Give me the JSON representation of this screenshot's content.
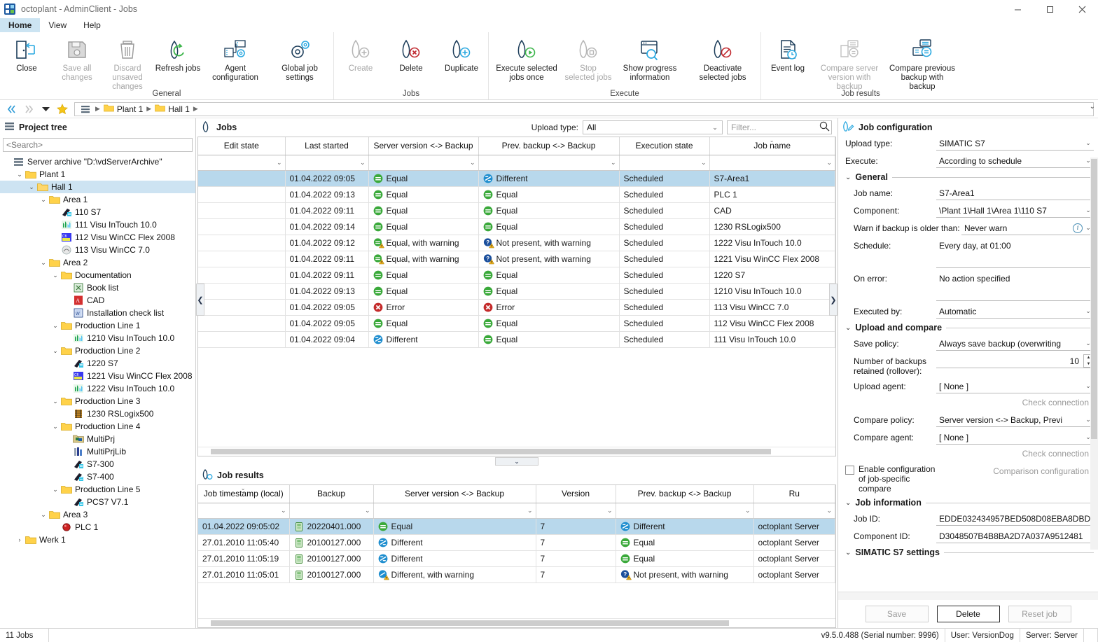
{
  "window": {
    "title": "octoplant - AdminClient - Jobs",
    "app_icon": "octoplant-logo-icon",
    "minimize": "minimize-icon",
    "maximize": "maximize-icon",
    "close": "close-icon"
  },
  "menubar": {
    "items": [
      "Home",
      "View",
      "Help"
    ],
    "active": "Home"
  },
  "ribbon": {
    "groups": [
      {
        "label": "General",
        "buttons": [
          {
            "label": "Close",
            "icon": "door-exit-icon",
            "disabled": false
          },
          {
            "label": "Save all changes",
            "icon": "floppy-save-icon",
            "disabled": true
          },
          {
            "label": "Discard unsaved changes",
            "icon": "trash-bin-icon",
            "disabled": true
          },
          {
            "label": "Refresh jobs",
            "icon": "refresh-arrows-icon",
            "disabled": false
          },
          {
            "label": "Agent configuration",
            "icon": "server-gear-icon",
            "disabled": false
          },
          {
            "label": "Global job settings",
            "icon": "gears-icon",
            "disabled": false
          }
        ]
      },
      {
        "label": "Jobs",
        "buttons": [
          {
            "label": "Create",
            "icon": "job-plus-icon",
            "disabled": true
          },
          {
            "label": "Delete",
            "icon": "job-delete-icon",
            "disabled": false
          },
          {
            "label": "Duplicate",
            "icon": "job-duplicate-icon",
            "disabled": false
          }
        ]
      },
      {
        "label": "Execute",
        "buttons": [
          {
            "label": "Execute selected jobs once",
            "icon": "job-play-icon",
            "disabled": false
          },
          {
            "label": "Stop selected jobs",
            "icon": "job-stop-icon",
            "disabled": true
          },
          {
            "label": "Show progress information",
            "icon": "window-search-icon",
            "disabled": false
          },
          {
            "label": "Deactivate selected jobs",
            "icon": "job-deactivate-icon",
            "disabled": false
          }
        ]
      },
      {
        "label": "Job results",
        "buttons": [
          {
            "label": "Event log",
            "icon": "document-clock-icon",
            "disabled": false
          },
          {
            "label": "Compare server version with backup",
            "icon": "compare-server-backup-icon",
            "disabled": true
          },
          {
            "label": "Compare previous backup with backup",
            "icon": "compare-backup-backup-icon",
            "disabled": false
          }
        ]
      }
    ]
  },
  "breadcrumb": {
    "back": "back-icon",
    "forward": "forward-icon",
    "history": "history-dropdown-icon",
    "favorite": "favorite-star-icon",
    "root": "project-tree-icon",
    "items": [
      "Plant 1",
      "Hall 1"
    ],
    "collapse": "ribbon-collapse-icon"
  },
  "tree_pane": {
    "icon": "project-tree-icon",
    "title": "Project tree",
    "search_placeholder": "<Search>",
    "search_value": "",
    "nodes": [
      {
        "label": "Server archive \"D:\\vdServerArchive\"",
        "depth": 0,
        "twist": "",
        "icon": "archive-icon",
        "selected": false
      },
      {
        "label": "Plant 1",
        "depth": 1,
        "twist": "v",
        "icon": "folder-icon",
        "selected": false
      },
      {
        "label": "Hall 1",
        "depth": 2,
        "twist": "v",
        "icon": "folder-open-icon",
        "selected": true
      },
      {
        "label": "Area 1",
        "depth": 3,
        "twist": "v",
        "icon": "folder-icon",
        "selected": false
      },
      {
        "label": "110 S7",
        "depth": 4,
        "twist": "",
        "icon": "plc-s7-icon",
        "selected": false
      },
      {
        "label": "111 Visu InTouch 10.0",
        "depth": 4,
        "twist": "",
        "icon": "hmi-intouch-icon",
        "selected": false
      },
      {
        "label": "112 Visu WinCC Flex 2008",
        "depth": 4,
        "twist": "",
        "icon": "hmi-winccflex-icon",
        "selected": false
      },
      {
        "label": "113 Visu WinCC 7.0",
        "depth": 4,
        "twist": "",
        "icon": "hmi-wincc-icon",
        "selected": false
      },
      {
        "label": "Area 2",
        "depth": 3,
        "twist": "v",
        "icon": "folder-icon",
        "selected": false
      },
      {
        "label": "Documentation",
        "depth": 4,
        "twist": "v",
        "icon": "folder-icon",
        "selected": false
      },
      {
        "label": "Book list",
        "depth": 5,
        "twist": "",
        "icon": "excel-file-icon",
        "selected": false
      },
      {
        "label": "CAD",
        "depth": 5,
        "twist": "",
        "icon": "pdf-file-icon",
        "selected": false
      },
      {
        "label": "Installation check list",
        "depth": 5,
        "twist": "",
        "icon": "word-file-icon",
        "selected": false
      },
      {
        "label": "Production Line 1",
        "depth": 4,
        "twist": "v",
        "icon": "folder-icon",
        "selected": false
      },
      {
        "label": "1210 Visu InTouch 10.0",
        "depth": 5,
        "twist": "",
        "icon": "hmi-intouch-icon",
        "selected": false
      },
      {
        "label": "Production Line 2",
        "depth": 4,
        "twist": "v",
        "icon": "folder-icon",
        "selected": false
      },
      {
        "label": "1220 S7",
        "depth": 5,
        "twist": "",
        "icon": "plc-s7-icon",
        "selected": false
      },
      {
        "label": "1221 Visu WinCC Flex 2008",
        "depth": 5,
        "twist": "",
        "icon": "hmi-winccflex-icon",
        "selected": false
      },
      {
        "label": "1222 Visu InTouch 10.0",
        "depth": 5,
        "twist": "",
        "icon": "hmi-intouch-icon",
        "selected": false
      },
      {
        "label": "Production Line 3",
        "depth": 4,
        "twist": "v",
        "icon": "folder-icon",
        "selected": false
      },
      {
        "label": "1230 RSLogix500",
        "depth": 5,
        "twist": "",
        "icon": "plc-rslogix-icon",
        "selected": false
      },
      {
        "label": "Production Line 4",
        "depth": 4,
        "twist": "v",
        "icon": "folder-icon",
        "selected": false
      },
      {
        "label": "MultiPrj",
        "depth": 5,
        "twist": "",
        "icon": "multiprj-icon",
        "selected": false
      },
      {
        "label": "MultiPrjLib",
        "depth": 5,
        "twist": "",
        "icon": "multiprjlib-icon",
        "selected": false
      },
      {
        "label": "S7-300",
        "depth": 5,
        "twist": "",
        "icon": "plc-s7-icon",
        "selected": false
      },
      {
        "label": "S7-400",
        "depth": 5,
        "twist": "",
        "icon": "plc-s7-icon",
        "selected": false
      },
      {
        "label": "Production Line 5",
        "depth": 4,
        "twist": "v",
        "icon": "folder-icon",
        "selected": false
      },
      {
        "label": "PCS7 V7.1",
        "depth": 5,
        "twist": "",
        "icon": "plc-s7-icon",
        "selected": false
      },
      {
        "label": "Area 3",
        "depth": 3,
        "twist": "v",
        "icon": "folder-icon",
        "selected": false
      },
      {
        "label": "PLC 1",
        "depth": 4,
        "twist": "",
        "icon": "plc-red-icon",
        "selected": false
      },
      {
        "label": "Werk 1",
        "depth": 1,
        "twist": ">",
        "icon": "folder-icon",
        "selected": false
      }
    ]
  },
  "jobs_panel": {
    "icon": "jobs-icon",
    "title": "Jobs",
    "upload_type_label": "Upload type:",
    "upload_type_value": "All",
    "filter_placeholder": "Filter...",
    "filter_value": "",
    "search_icon": "search-icon",
    "columns": [
      "Edit state",
      "Last started",
      "Server version <-> Backup",
      "Prev. backup <-> Backup",
      "Execution state",
      "Job name"
    ],
    "sorted_column": "Job name",
    "rows": [
      {
        "edit_state": "",
        "last_started": "01.04.2022 09:05",
        "server_vs_backup": "Equal",
        "server_vs_backup_icon": "equal-green-icon",
        "prev_vs_backup": "Different",
        "prev_vs_backup_icon": "different-blue-icon",
        "execution_state": "Scheduled",
        "job_name": "S7-Area1",
        "selected": true
      },
      {
        "edit_state": "",
        "last_started": "01.04.2022 09:13",
        "server_vs_backup": "Equal",
        "server_vs_backup_icon": "equal-green-icon",
        "prev_vs_backup": "Equal",
        "prev_vs_backup_icon": "equal-green-icon",
        "execution_state": "Scheduled",
        "job_name": "PLC 1",
        "selected": false
      },
      {
        "edit_state": "",
        "last_started": "01.04.2022 09:11",
        "server_vs_backup": "Equal",
        "server_vs_backup_icon": "equal-green-icon",
        "prev_vs_backup": "Equal",
        "prev_vs_backup_icon": "equal-green-icon",
        "execution_state": "Scheduled",
        "job_name": "CAD",
        "selected": false
      },
      {
        "edit_state": "",
        "last_started": "01.04.2022 09:14",
        "server_vs_backup": "Equal",
        "server_vs_backup_icon": "equal-green-icon",
        "prev_vs_backup": "Equal",
        "prev_vs_backup_icon": "equal-green-icon",
        "execution_state": "Scheduled",
        "job_name": "1230 RSLogix500",
        "selected": false
      },
      {
        "edit_state": "",
        "last_started": "01.04.2022 09:12",
        "server_vs_backup": "Equal, with warning",
        "server_vs_backup_icon": "equal-warning-icon",
        "prev_vs_backup": "Not present, with warning",
        "prev_vs_backup_icon": "notpresent-warning-icon",
        "execution_state": "Scheduled",
        "job_name": "1222 Visu InTouch 10.0",
        "selected": false
      },
      {
        "edit_state": "",
        "last_started": "01.04.2022 09:11",
        "server_vs_backup": "Equal, with warning",
        "server_vs_backup_icon": "equal-warning-icon",
        "prev_vs_backup": "Not present, with warning",
        "prev_vs_backup_icon": "notpresent-warning-icon",
        "execution_state": "Scheduled",
        "job_name": "1221 Visu WinCC Flex 2008",
        "selected": false
      },
      {
        "edit_state": "",
        "last_started": "01.04.2022 09:11",
        "server_vs_backup": "Equal",
        "server_vs_backup_icon": "equal-green-icon",
        "prev_vs_backup": "Equal",
        "prev_vs_backup_icon": "equal-green-icon",
        "execution_state": "Scheduled",
        "job_name": "1220 S7",
        "selected": false
      },
      {
        "edit_state": "",
        "last_started": "01.04.2022 09:13",
        "server_vs_backup": "Equal",
        "server_vs_backup_icon": "equal-green-icon",
        "prev_vs_backup": "Equal",
        "prev_vs_backup_icon": "equal-green-icon",
        "execution_state": "Scheduled",
        "job_name": "1210 Visu InTouch 10.0",
        "selected": false
      },
      {
        "edit_state": "",
        "last_started": "01.04.2022 09:05",
        "server_vs_backup": "Error",
        "server_vs_backup_icon": "error-red-icon",
        "prev_vs_backup": "Error",
        "prev_vs_backup_icon": "error-red-icon",
        "execution_state": "Scheduled",
        "job_name": "113 Visu WinCC 7.0",
        "selected": false
      },
      {
        "edit_state": "",
        "last_started": "01.04.2022 09:05",
        "server_vs_backup": "Equal",
        "server_vs_backup_icon": "equal-green-icon",
        "prev_vs_backup": "Equal",
        "prev_vs_backup_icon": "equal-green-icon",
        "execution_state": "Scheduled",
        "job_name": "112 Visu WinCC Flex 2008",
        "selected": false
      },
      {
        "edit_state": "",
        "last_started": "01.04.2022 09:04",
        "server_vs_backup": "Different",
        "server_vs_backup_icon": "different-blue-icon",
        "prev_vs_backup": "Equal",
        "prev_vs_backup_icon": "equal-green-icon",
        "execution_state": "Scheduled",
        "job_name": "111 Visu InTouch 10.0",
        "selected": false
      }
    ]
  },
  "results_panel": {
    "icon": "job-results-icon",
    "title": "Job results",
    "columns": [
      "Job timestamp (local)",
      "Backup",
      "Server version <-> Backup",
      "Version",
      "Prev. backup <-> Backup",
      "Ru"
    ],
    "sorted_column": "Job timestamp (local)",
    "rows": [
      {
        "timestamp": "01.04.2022 09:05:02",
        "backup": "20220401.000",
        "backup_icon": "backup-db-icon",
        "server_vs_backup": "Equal",
        "server_vs_backup_icon": "equal-green-icon",
        "version": "7",
        "prev_vs_backup": "Different",
        "prev_vs_backup_icon": "different-blue-icon",
        "run_by": "octoplant Server",
        "selected": true
      },
      {
        "timestamp": "27.01.2010 11:05:40",
        "backup": "20100127.000",
        "backup_icon": "backup-db-icon",
        "server_vs_backup": "Different",
        "server_vs_backup_icon": "different-blue-icon",
        "version": "7",
        "prev_vs_backup": "Equal",
        "prev_vs_backup_icon": "equal-green-icon",
        "run_by": "octoplant Server",
        "selected": false
      },
      {
        "timestamp": "27.01.2010 11:05:19",
        "backup": "20100127.000",
        "backup_icon": "backup-db-icon",
        "server_vs_backup": "Different",
        "server_vs_backup_icon": "different-blue-icon",
        "version": "7",
        "prev_vs_backup": "Equal",
        "prev_vs_backup_icon": "equal-green-icon",
        "run_by": "octoplant Server",
        "selected": false
      },
      {
        "timestamp": "27.01.2010 11:05:01",
        "backup": "20100127.000",
        "backup_icon": "backup-db-icon",
        "server_vs_backup": "Different, with warning",
        "server_vs_backup_icon": "different-warning-icon",
        "version": "7",
        "prev_vs_backup": "Not present, with warning",
        "prev_vs_backup_icon": "notpresent-warning-icon",
        "run_by": "octoplant Server",
        "selected": false
      }
    ]
  },
  "config_panel": {
    "icon": "job-configuration-icon",
    "title": "Job configuration",
    "upload_type_label": "Upload type:",
    "upload_type_value": "SIMATIC S7",
    "execute_label": "Execute:",
    "execute_value": "According to schedule",
    "sections": {
      "general": {
        "title": "General",
        "job_name_label": "Job name:",
        "job_name_value": "S7-Area1",
        "component_label": "Component:",
        "component_value": "\\Plant 1\\Hall 1\\Area 1\\110 S7",
        "warn_label": "Warn if backup is older than:",
        "warn_value": "Never warn",
        "schedule_label": "Schedule:",
        "schedule_value": "Every day, at 01:00",
        "on_error_label": "On error:",
        "on_error_value": "No action specified",
        "executed_by_label": "Executed by:",
        "executed_by_value": "Automatic"
      },
      "upload_compare": {
        "title": "Upload and compare",
        "save_policy_label": "Save policy:",
        "save_policy_value": "Always save backup (overwriting",
        "rollover_label": "Number of backups retained (rollover):",
        "rollover_value": "10",
        "upload_agent_label": "Upload agent:",
        "upload_agent_value": "[ None ]",
        "check_connection_1": "Check connection",
        "compare_policy_label": "Compare policy:",
        "compare_policy_value": "Server version <-> Backup, Previ",
        "compare_agent_label": "Compare agent:",
        "compare_agent_value": "[ None ]",
        "check_connection_2": "Check connection",
        "enable_job_compare_label": "Enable configuration of job-specific compare",
        "enable_job_compare_checked": false,
        "comparison_configuration": "Comparison configuration"
      },
      "job_information": {
        "title": "Job information",
        "job_id_label": "Job ID:",
        "job_id_value": "EDDE032434957BED508D08EBA8DBD",
        "component_id_label": "Component ID:",
        "component_id_value": "D3048507B4B8BA2D7A037A9512481"
      },
      "simatic": {
        "title": "SIMATIC S7 settings"
      }
    },
    "buttons": {
      "save": "Save",
      "delete": "Delete",
      "reset": "Reset job"
    }
  },
  "statusbar": {
    "left": "11 Jobs",
    "version": "v9.5.0.488 (Serial number: 9996)",
    "user": "User: VersionDog",
    "server": "Server: Server"
  },
  "colors": {
    "accent": "#1e5aa0",
    "selection": "#b8d8ec",
    "tree_selection": "#cde3f2",
    "status_equal": "#3aa93a",
    "status_different": "#1f8ecf",
    "status_error": "#c42b2b",
    "status_warning": "#f0b323",
    "folder": "#ffd24a"
  }
}
